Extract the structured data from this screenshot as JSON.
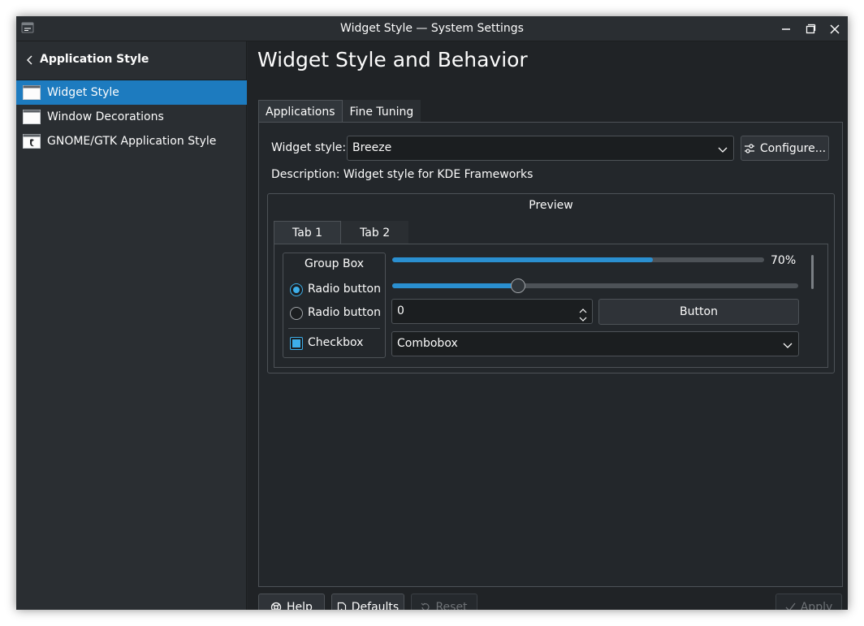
{
  "window": {
    "title": "Widget Style — System Settings"
  },
  "sidebar": {
    "back_label": "Application Style",
    "items": [
      {
        "label": "Widget Style",
        "active": true
      },
      {
        "label": "Window Decorations",
        "active": false
      },
      {
        "label": "GNOME/GTK Application Style",
        "active": false
      }
    ]
  },
  "main": {
    "page_title": "Widget Style and Behavior",
    "tabs": [
      {
        "label": "Applications",
        "active": true
      },
      {
        "label": "Fine Tuning",
        "active": false
      }
    ],
    "widget_style_label": "Widget style:",
    "widget_style_value": "Breeze",
    "configure_label": "Configure...",
    "description": "Description: Widget style for KDE Frameworks",
    "preview": {
      "title": "Preview",
      "tabs": [
        {
          "label": "Tab 1",
          "active": true
        },
        {
          "label": "Tab 2",
          "active": false
        }
      ],
      "group_box": {
        "title": "Group Box",
        "radio1": "Radio button",
        "radio2": "Radio button",
        "checkbox": "Checkbox"
      },
      "progress": {
        "value": 0.7,
        "label": "70%"
      },
      "slider": {
        "value": 0.31
      },
      "spinbox_value": "0",
      "button_label": "Button",
      "combobox_value": "Combobox"
    }
  },
  "footer": {
    "help": "Help",
    "defaults": "Defaults",
    "reset": "Reset",
    "apply": "Apply"
  },
  "colors": {
    "accent": "#3daee9",
    "selection": "#1d7bbf",
    "background": "#232629"
  },
  "icons": [
    "settings-app-icon",
    "minimize-icon",
    "maximize-icon",
    "close-icon",
    "back-chevron-icon",
    "window-icon",
    "gtk-icon",
    "chevron-down-icon",
    "configure-icon",
    "help-icon",
    "defaults-icon",
    "reset-icon",
    "apply-check-icon"
  ]
}
